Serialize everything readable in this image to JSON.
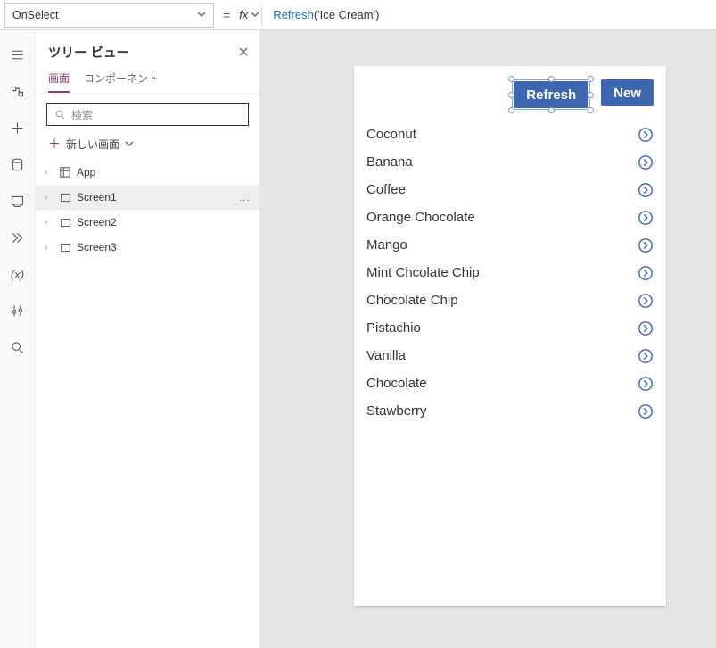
{
  "formula_bar": {
    "property": "OnSelect",
    "equals": "=",
    "fx": "fx",
    "formula_fn": "Refresh",
    "formula_arg": "('Ice Cream')"
  },
  "tree": {
    "title": "ツリー ビュー",
    "tabs": {
      "screens": "画面",
      "components": "コンポーネント"
    },
    "search_placeholder": "検索",
    "new_screen": "新しい画面",
    "items": {
      "app": "App",
      "screen1": "Screen1",
      "screen2": "Screen2",
      "screen3": "Screen3"
    },
    "more": "..."
  },
  "phone": {
    "refresh": "Refresh",
    "new": "New",
    "list": [
      "Coconut",
      "Banana",
      "Coffee",
      "Orange Chocolate",
      "Mango",
      "Mint Chcolate Chip",
      "Chocolate Chip",
      "Pistachio",
      "Vanilla",
      "Chocolate",
      "Stawberry"
    ]
  }
}
